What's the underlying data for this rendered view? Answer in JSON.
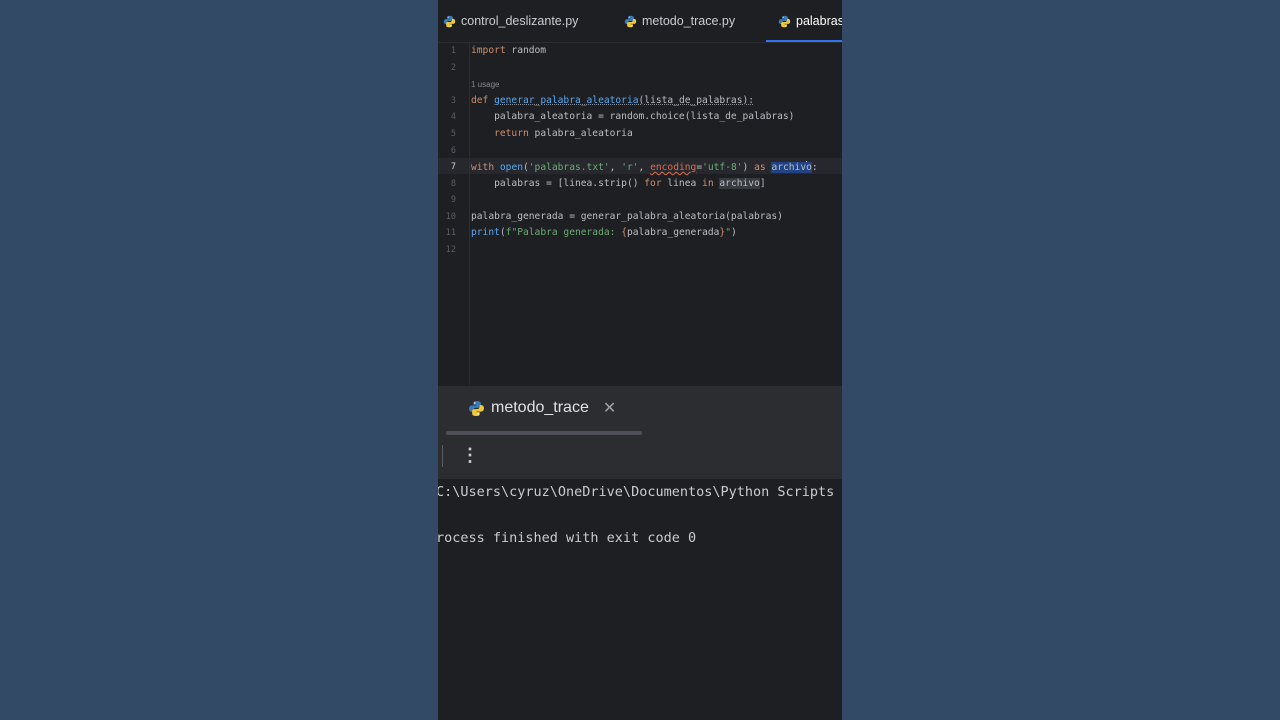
{
  "tabs": [
    {
      "label": "control_deslizante.py",
      "icon": "python-icon"
    },
    {
      "label": "metodo_trace.py",
      "icon": "python-icon"
    },
    {
      "label": "palabras",
      "icon": "python-icon",
      "active": true
    }
  ],
  "editor": {
    "line_numbers": [
      "1",
      "2",
      "",
      "3",
      "4",
      "5",
      "6",
      "7",
      "8",
      "9",
      "10",
      "11",
      "12"
    ],
    "usage_hint": "1 usage",
    "code": {
      "l1_kw": "import",
      "l1_rest": " random",
      "l3_kw": "def ",
      "l3_name": "generar_palabra_aleatoria",
      "l3_sig": "(lista_de_palabras):",
      "l4": "    palabra_aleatoria = random.choice(lista_de_palabras)",
      "l5_indent": "    ",
      "l5_kw": "return",
      "l5_rest": " palabra_aleatoria",
      "l7_with": "with ",
      "l7_open": "open",
      "l7_p1": "(",
      "l7_s1": "'palabras.txt'",
      "l7_c1": ", ",
      "l7_s2": "'r'",
      "l7_c2": ", ",
      "l7_param": "encoding",
      "l7_eq": "=",
      "l7_s3": "'utf-8'",
      "l7_p2": ") ",
      "l7_as": "as",
      "l7_sp": " ",
      "l7_var_a": "archiv",
      "l7_var_b": "o",
      "l7_end": ":",
      "l8_a": "    palabras = [linea.strip() ",
      "l8_for": "for",
      "l8_b": " linea ",
      "l8_in": "in",
      "l8_sp": " ",
      "l8_var": "archivo",
      "l8_end": "]",
      "l10": "palabra_generada = generar_palabra_aleatoria(palabras)",
      "l11_print": "print",
      "l11_a": "(",
      "l11_s1": "f\"Palabra generada: ",
      "l11_b1": "{",
      "l11_var": "palabra_generada",
      "l11_b2": "}",
      "l11_s2": "\"",
      "l11_end": ")"
    }
  },
  "run_panel": {
    "tab_label": "metodo_trace",
    "close_glyph": "✕",
    "more_glyph": "⋮",
    "console_lines": [
      "C:\\Users\\cyruz\\OneDrive\\Documentos\\Python Scripts",
      "rocess finished with exit code 0"
    ]
  },
  "colors": {
    "background": "#334a66",
    "editor_bg": "#1e1f22",
    "keyword": "#cf8e6d",
    "function": "#56a8f5",
    "string": "#6aab73",
    "accent": "#3574f0"
  }
}
